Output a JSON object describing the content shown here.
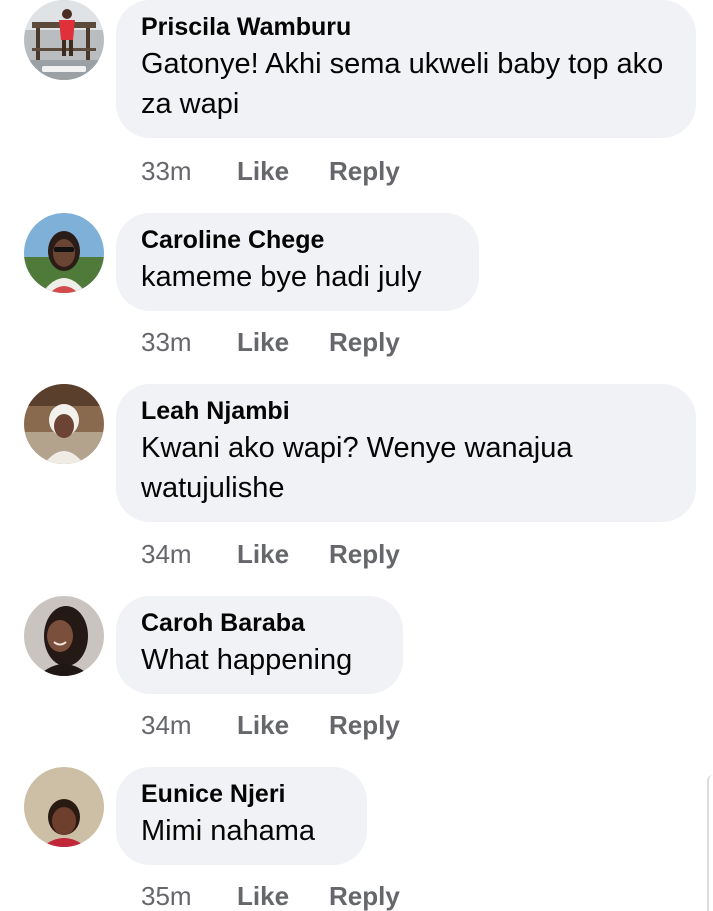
{
  "comments": [
    {
      "author": "Priscila Wamburu",
      "text": "Gatonye! Akhi sema ukweli baby top ako za wapi",
      "time": "33m",
      "like": "Like",
      "reply": "Reply",
      "avatar_icon": "profile-photo-icon"
    },
    {
      "author": "Caroline Chege",
      "text": "kameme bye hadi july",
      "time": "33m",
      "like": "Like",
      "reply": "Reply",
      "avatar_icon": "profile-photo-icon"
    },
    {
      "author": "Leah Njambi",
      "text": "Kwani ako wapi? Wenye wanajua watujulishe",
      "time": "34m",
      "like": "Like",
      "reply": "Reply",
      "avatar_icon": "profile-photo-icon"
    },
    {
      "author": "Caroh Baraba",
      "text": "What happening",
      "time": "34m",
      "like": "Like",
      "reply": "Reply",
      "avatar_icon": "profile-photo-icon"
    },
    {
      "author": "Eunice Njeri",
      "text": "Mimi nahama",
      "time": "35m",
      "like": "Like",
      "reply": "Reply",
      "avatar_icon": "profile-photo-icon"
    }
  ],
  "colors": {
    "bubble_background": "#f0f2f5",
    "author_text": "#050505",
    "meta_text": "#65676b"
  }
}
